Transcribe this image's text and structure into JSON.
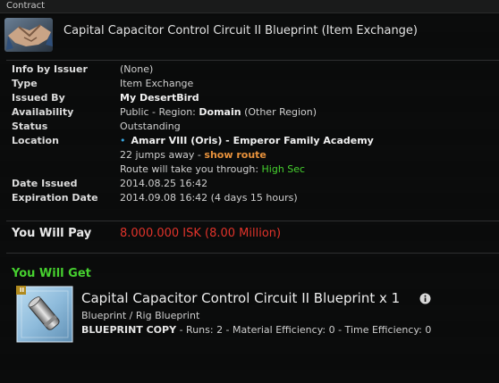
{
  "window": {
    "title": "Contract"
  },
  "header": {
    "title": "Capital Capacitor Control Circuit II Blueprint (Item Exchange)",
    "icon": "handshake-icon"
  },
  "info": {
    "info_by_issuer_label": "Info by Issuer",
    "info_by_issuer_value": "(None)",
    "type_label": "Type",
    "type_value": "Item Exchange",
    "issued_by_label": "Issued By",
    "issued_by_value": "My DesertBird",
    "availability_label": "Availability",
    "availability_prefix": "Public - Region: ",
    "availability_region": "Domain",
    "availability_suffix": " (Other Region)",
    "status_label": "Status",
    "status_value": "Outstanding",
    "location_label": "Location",
    "location_value": "Amarr VIII (Oris) - Emperor Family Academy",
    "jumps_text": "22 jumps away - ",
    "show_route": "show route",
    "route_text": "Route will take you through: ",
    "route_sec": "High Sec",
    "date_issued_label": "Date Issued",
    "date_issued_value": "2014.08.25 16:42",
    "expiration_label": "Expiration Date",
    "expiration_value": "2014.09.08 16:42 (4 days 15 hours)"
  },
  "pay": {
    "label": "You Will Pay",
    "value": "8.000.000 ISK (8.00 Million)"
  },
  "get": {
    "label": "You Will Get",
    "item_title": "Capital Capacitor Control Circuit II Blueprint x 1",
    "item_category": "Blueprint / Rig Blueprint",
    "copy_label": "BLUEPRINT COPY",
    "copy_details": " - Runs: 2 - Material Efficiency: 0 - Time Efficiency: 0",
    "tech_badge": "II"
  },
  "colors": {
    "accent_green": "#46d12f",
    "price_red": "#e0332a",
    "link_orange": "#e8923c"
  }
}
